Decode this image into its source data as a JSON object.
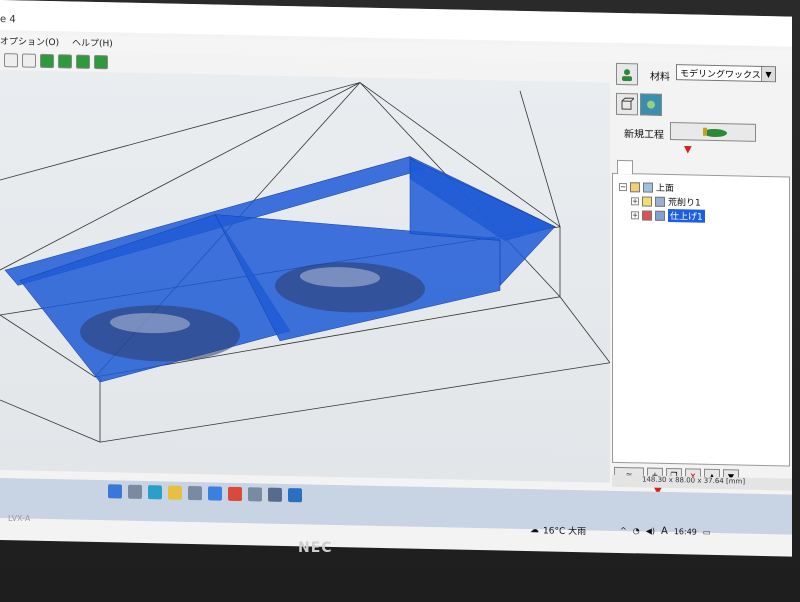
{
  "window": {
    "title": "e 4"
  },
  "menu": {
    "items": [
      "オプション(O)",
      "ヘルプ(H)"
    ]
  },
  "material": {
    "label": "材料",
    "value": "モデリングワックス"
  },
  "process": {
    "new_label": "新規工程"
  },
  "tree": {
    "root": "上面",
    "items": [
      {
        "label": "荒削り1",
        "selected": false
      },
      {
        "label": "仕上げ1",
        "selected": true
      }
    ]
  },
  "status": {
    "dimensions": "148.30 x 88.00 x 37.64 [mm]"
  },
  "taskbar": {
    "weather": "16°C 大雨",
    "time": "16:49"
  },
  "laptop": {
    "brand": "NEC",
    "model": "LVX-A"
  },
  "colors": {
    "toolpath": "#1f5bd6",
    "selection": "#1d5fe0",
    "arrow": "#d62020"
  }
}
